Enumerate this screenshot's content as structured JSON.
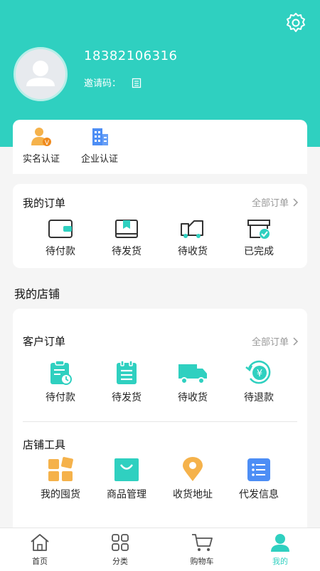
{
  "profile": {
    "phone": "18382106316",
    "invite_label": "邀请码："
  },
  "auth": {
    "real_name": "实名认证",
    "enterprise": "企业认证"
  },
  "orders": {
    "title": "我的订单",
    "all_link": "全部订单",
    "items": [
      "待付款",
      "待发货",
      "待收货",
      "已完成"
    ]
  },
  "shop": {
    "title": "我的店铺",
    "customer_orders": {
      "title": "客户订单",
      "all_link": "全部订单",
      "items": [
        "待付款",
        "待发货",
        "待收货",
        "待退款"
      ]
    },
    "tools": {
      "title": "店铺工具",
      "items": [
        "我的囤货",
        "商品管理",
        "收货地址",
        "代发信息"
      ]
    }
  },
  "tabbar": {
    "items": [
      "首页",
      "分类",
      "购物车",
      "我的"
    ]
  },
  "colors": {
    "accent": "#2fd0c0",
    "orange": "#f5b24b",
    "blue": "#4d8ef5"
  }
}
